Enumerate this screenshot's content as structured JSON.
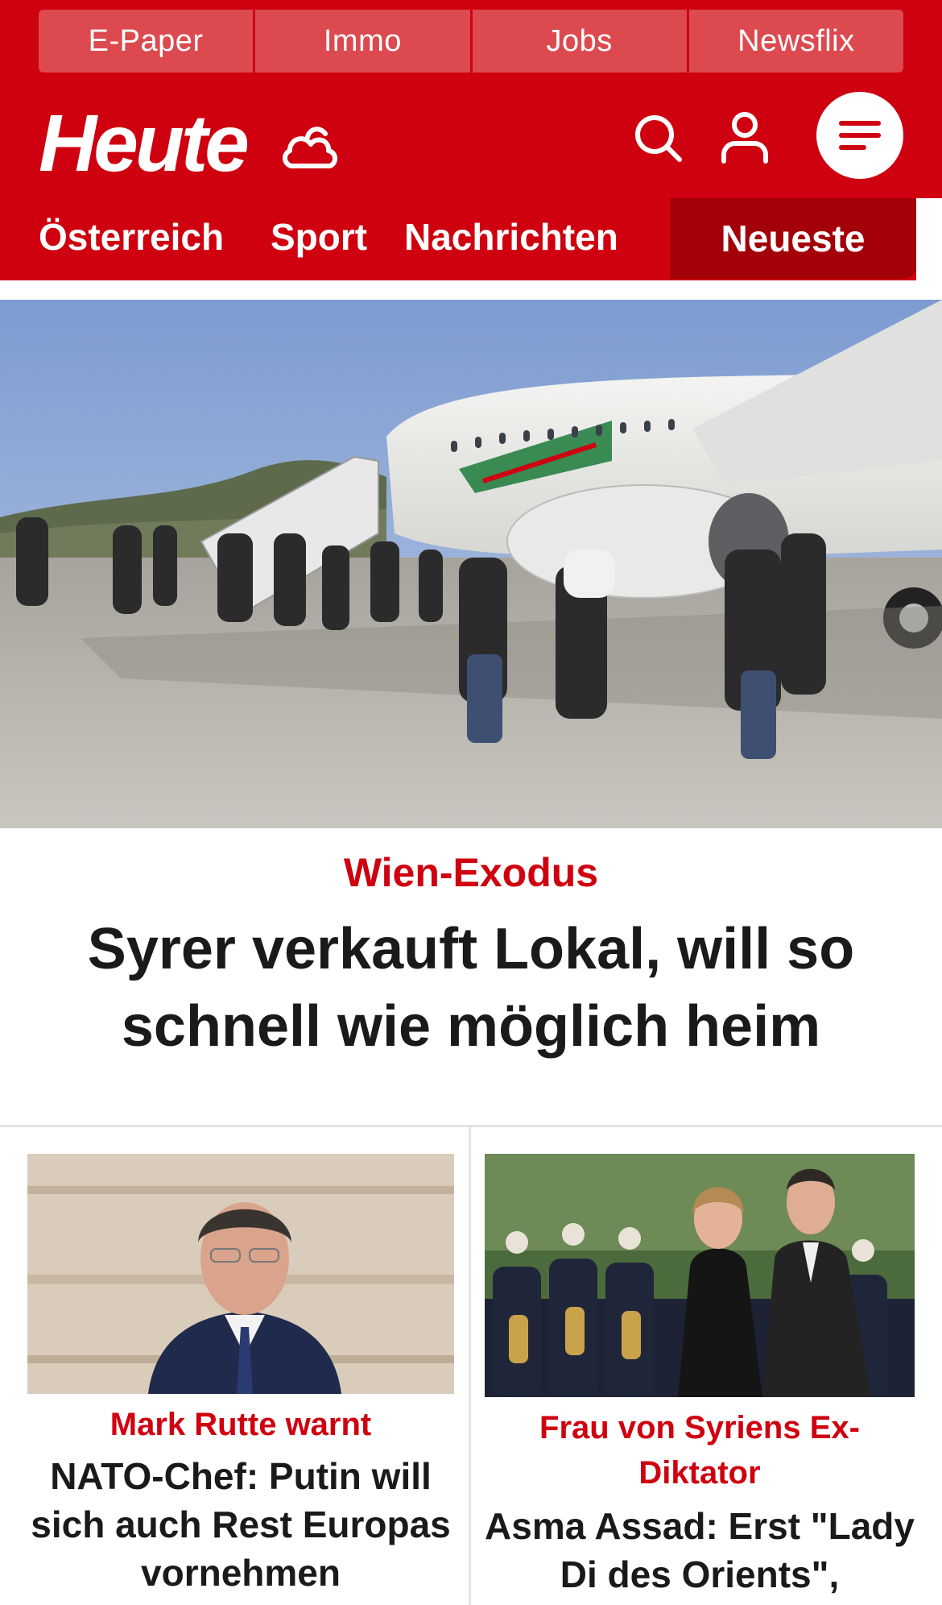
{
  "topbar": {
    "items": [
      {
        "label": "E-Paper"
      },
      {
        "label": "Immo"
      },
      {
        "label": "Jobs"
      },
      {
        "label": "Newsflix"
      }
    ]
  },
  "header": {
    "logo_text": "Heute",
    "weather_icon": "cloud-sun-icon",
    "search_icon": "search-icon",
    "user_icon": "user-icon",
    "menu_icon": "hamburger-menu-icon"
  },
  "nav": {
    "items": [
      {
        "label": "Österreich"
      },
      {
        "label": "Sport"
      },
      {
        "label": "Nachrichten"
      }
    ],
    "active_label": "Neueste"
  },
  "hero": {
    "kicker": "Wien-Exodus",
    "title": "Syrer verkauft Lokal, will so schnell wie möglich heim"
  },
  "cards": [
    {
      "kicker": "Mark Rutte warnt",
      "title": "NATO-Chef: Putin will sich auch Rest Europas vornehmen"
    },
    {
      "kicker": "Frau von Syriens Ex-Diktator",
      "title": "Asma Assad: Erst \"Lady Di des Orients\","
    }
  ],
  "colors": {
    "brand_red": "#cf000f",
    "active_tab": "#a30009",
    "topbar_item": "#dc4a4f"
  }
}
